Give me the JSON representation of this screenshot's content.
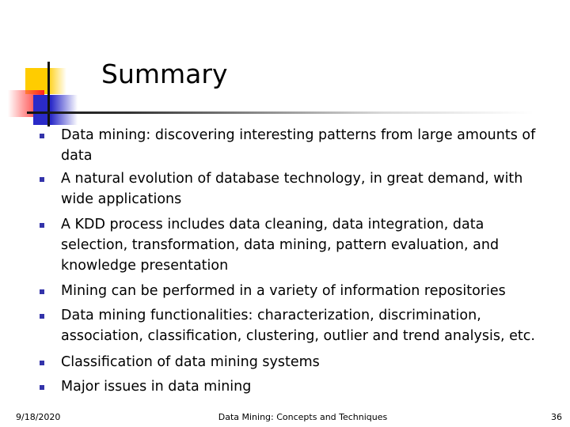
{
  "slide": {
    "title": "Summary",
    "bullets": [
      {
        "text": "Data mining: discovering interesting patterns from large amounts of\ndata"
      },
      {
        "text": "A natural evolution of database technology, in great demand, with\nwide applications"
      },
      {
        "text": "A KDD process includes data cleaning, data integration, data\nselection, transformation, data mining, pattern evaluation, and\nknowledge presentation"
      },
      {
        "text": "Mining can be performed in a variety of information repositories"
      },
      {
        "text": "Data mining functionalities: characterization, discrimination,\nassociation, classification, clustering, outlier and trend analysis, etc."
      },
      {
        "text": "Classification of data mining systems"
      },
      {
        "text": "Major issues in data mining"
      }
    ],
    "bullet_icon": "square-bullet",
    "colors": {
      "bullet": "#3333aa",
      "logo_yellow": "#ffcc00",
      "logo_red": "#ff2020",
      "logo_blue": "#2a2ac8"
    }
  },
  "footer": {
    "date": "9/18/2020",
    "title": "Data Mining: Concepts and Techniques",
    "page": "36"
  }
}
